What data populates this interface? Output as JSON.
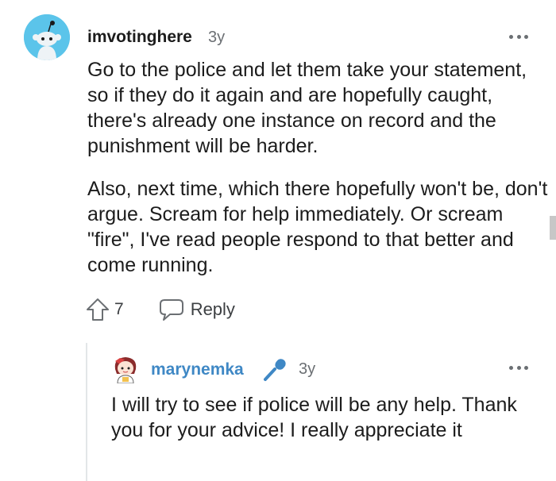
{
  "comment": {
    "username": "imvotinghere",
    "age": "3y",
    "paragraphs": [
      "Go to the police and let them take your statement, so if they do it again and are hopefully caught, there's already one instance on record and the punishment will be harder.",
      "Also, next time, which there hopefully won't be, don't argue. Scream for help immediately. Or scream \"fire\", I've read people respond to that better and come running."
    ],
    "votes": "7",
    "reply_label": "Reply",
    "icons": {
      "avatar": "reddit-snoo-avatar",
      "upvote": "upvote-arrow-icon",
      "reply": "speech-bubble-icon",
      "more": "more-options-icon"
    },
    "colors": {
      "avatar_bg": "#5bc4ea"
    }
  },
  "reply": {
    "username": "marynemka",
    "age": "3y",
    "text": "I will try to see if police will be any help. Thank you for your advice! I really appreciate it",
    "icons": {
      "avatar": "custom-avatar",
      "badge": "microphone-icon",
      "more": "more-options-icon"
    },
    "colors": {
      "username": "#3f88c5",
      "badge": "#3f88c5"
    }
  }
}
